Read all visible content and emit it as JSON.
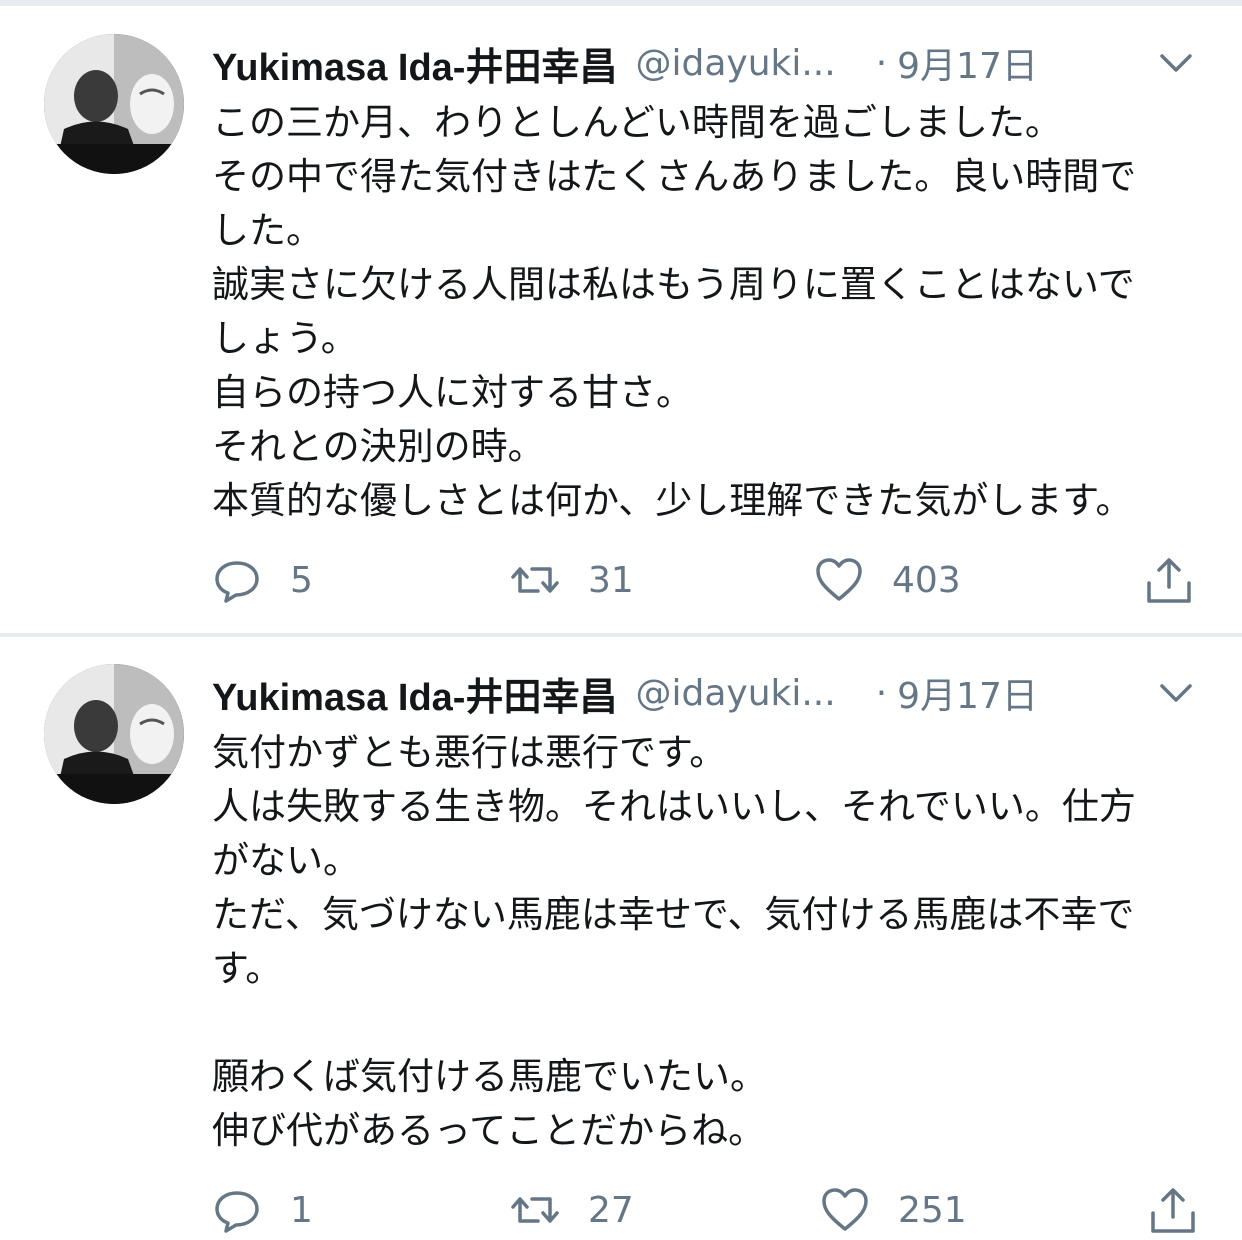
{
  "tweets": [
    {
      "author_name": "Yukimasa Ida-井田幸昌",
      "handle": "@idayuki...",
      "separator": "·",
      "date": "9月17日",
      "lines": [
        "この三か月、わりとしんどい時間を過ごしました。",
        "その中で得た気付きはたくさんありました。良い時間で",
        "した。",
        "誠実さに欠ける人間は私はもう周りに置くことはないで",
        "しょう。",
        "自らの持つ人に対する甘さ。",
        "それとの決別の時。",
        "本質的な優しさとは何か、少し理解できた気がします。"
      ],
      "reply_count": "5",
      "retweet_count": "31",
      "like_count": "403"
    },
    {
      "author_name": "Yukimasa Ida-井田幸昌",
      "handle": "@idayuki...",
      "separator": "·",
      "date": "9月17日",
      "lines": [
        "気付かずとも悪行は悪行です。",
        "人は失敗する生き物。それはいいし、それでいい。仕方",
        "がない。",
        "ただ、気づけない馬鹿は幸せで、気付ける馬鹿は不幸で",
        "す。",
        "",
        "願わくば気付ける馬鹿でいたい。",
        "伸び代があるってことだからね。"
      ],
      "reply_count": "1",
      "retweet_count": "27",
      "like_count": "251"
    }
  ],
  "icons": {
    "reply": "reply-icon",
    "retweet": "retweet-icon",
    "like": "heart-icon",
    "share": "share-icon",
    "menu": "chevron-down-icon"
  },
  "colors": {
    "text": "#14171a",
    "secondary": "#657786",
    "divider": "#e6ecf0"
  }
}
